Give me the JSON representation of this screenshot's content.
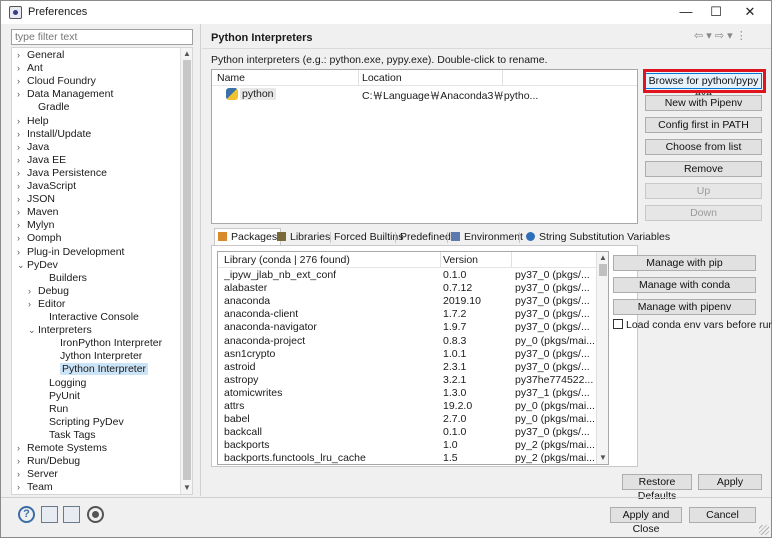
{
  "window": {
    "title": "Preferences",
    "minimize": "—",
    "maximize": "☐",
    "close": "✕"
  },
  "filter": {
    "placeholder": "type filter text"
  },
  "tree": {
    "items": [
      {
        "label": "General",
        "chev": "›"
      },
      {
        "label": "Ant",
        "chev": "›"
      },
      {
        "label": "Cloud Foundry",
        "chev": "›"
      },
      {
        "label": "Data Management",
        "chev": "›"
      },
      {
        "label": "Gradle",
        "chev": ""
      },
      {
        "label": "Help",
        "chev": "›"
      },
      {
        "label": "Install/Update",
        "chev": "›"
      },
      {
        "label": "Java",
        "chev": "›"
      },
      {
        "label": "Java EE",
        "chev": "›"
      },
      {
        "label": "Java Persistence",
        "chev": "›"
      },
      {
        "label": "JavaScript",
        "chev": "›"
      },
      {
        "label": "JSON",
        "chev": "›"
      },
      {
        "label": "Maven",
        "chev": "›"
      },
      {
        "label": "Mylyn",
        "chev": "›"
      },
      {
        "label": "Oomph",
        "chev": "›"
      },
      {
        "label": "Plug-in Development",
        "chev": "›"
      },
      {
        "label": "PyDev",
        "chev": "⌄"
      },
      {
        "label": "Builders",
        "chev": ""
      },
      {
        "label": "Debug",
        "chev": "›"
      },
      {
        "label": "Editor",
        "chev": "›"
      },
      {
        "label": "Interactive Console",
        "chev": ""
      },
      {
        "label": "Interpreters",
        "chev": "⌄"
      },
      {
        "label": "IronPython Interpreter",
        "chev": ""
      },
      {
        "label": "Jython Interpreter",
        "chev": ""
      },
      {
        "label": "Python Interpreter",
        "chev": ""
      },
      {
        "label": "Logging",
        "chev": ""
      },
      {
        "label": "PyUnit",
        "chev": ""
      },
      {
        "label": "Run",
        "chev": ""
      },
      {
        "label": "Scripting PyDev",
        "chev": ""
      },
      {
        "label": "Task Tags",
        "chev": ""
      },
      {
        "label": "Remote Systems",
        "chev": "›"
      },
      {
        "label": "Run/Debug",
        "chev": "›"
      },
      {
        "label": "Server",
        "chev": "›"
      },
      {
        "label": "Team",
        "chev": "›"
      }
    ]
  },
  "panel": {
    "title": "Python Interpreters",
    "nav": "⇦ ▾ ⇨ ▾ ⋮",
    "description": "Python interpreters (e.g.: python.exe, pypy.exe).   Double-click to rename.",
    "table_headers": {
      "name": "Name",
      "location": "Location"
    },
    "interpreter": {
      "name": "python",
      "location": "C:￦Language￦Anaconda3￦pytho..."
    },
    "buttons": {
      "browse": "Browse for python/pypy exe",
      "pipenv": "New with Pipenv",
      "config_path": "Config first in PATH",
      "choose": "Choose from list",
      "remove": "Remove",
      "up": "Up",
      "down": "Down"
    },
    "tabs": [
      "Packages",
      "Libraries",
      "Forced Builtins",
      "Predefined",
      "Environment",
      "String Substitution Variables"
    ],
    "lib_headers": {
      "library": "Library (conda | 276 found)",
      "version": "Version"
    },
    "libraries": [
      {
        "name": "_ipyw_jlab_nb_ext_conf",
        "version": "0.1.0",
        "build": "py37_0 (pkgs/..."
      },
      {
        "name": "alabaster",
        "version": "0.7.12",
        "build": "py37_0 (pkgs/..."
      },
      {
        "name": "anaconda",
        "version": "2019.10",
        "build": "py37_0 (pkgs/..."
      },
      {
        "name": "anaconda-client",
        "version": "1.7.2",
        "build": "py37_0 (pkgs/..."
      },
      {
        "name": "anaconda-navigator",
        "version": "1.9.7",
        "build": "py37_0 (pkgs/..."
      },
      {
        "name": "anaconda-project",
        "version": "0.8.3",
        "build": "py_0 (pkgs/mai..."
      },
      {
        "name": "asn1crypto",
        "version": "1.0.1",
        "build": "py37_0 (pkgs/..."
      },
      {
        "name": "astroid",
        "version": "2.3.1",
        "build": "py37_0 (pkgs/..."
      },
      {
        "name": "astropy",
        "version": "3.2.1",
        "build": "py37he774522..."
      },
      {
        "name": "atomicwrites",
        "version": "1.3.0",
        "build": "py37_1 (pkgs/..."
      },
      {
        "name": "attrs",
        "version": "19.2.0",
        "build": "py_0 (pkgs/mai..."
      },
      {
        "name": "babel",
        "version": "2.7.0",
        "build": "py_0 (pkgs/mai..."
      },
      {
        "name": "backcall",
        "version": "0.1.0",
        "build": "py37_0 (pkgs/..."
      },
      {
        "name": "backports",
        "version": "1.0",
        "build": "py_2 (pkgs/mai..."
      },
      {
        "name": "backports.functools_lru_cache",
        "version": "1.5",
        "build": "py_2 (pkgs/mai..."
      }
    ],
    "pkg_buttons": {
      "pip": "Manage with pip",
      "conda": "Manage with conda",
      "pipenv": "Manage with pipenv"
    },
    "conda_checkbox": "Load conda env vars before run?",
    "restore_defaults": "Restore Defaults",
    "apply": "Apply"
  },
  "footer": {
    "help": "?",
    "apply_close": "Apply and Close",
    "cancel": "Cancel"
  }
}
